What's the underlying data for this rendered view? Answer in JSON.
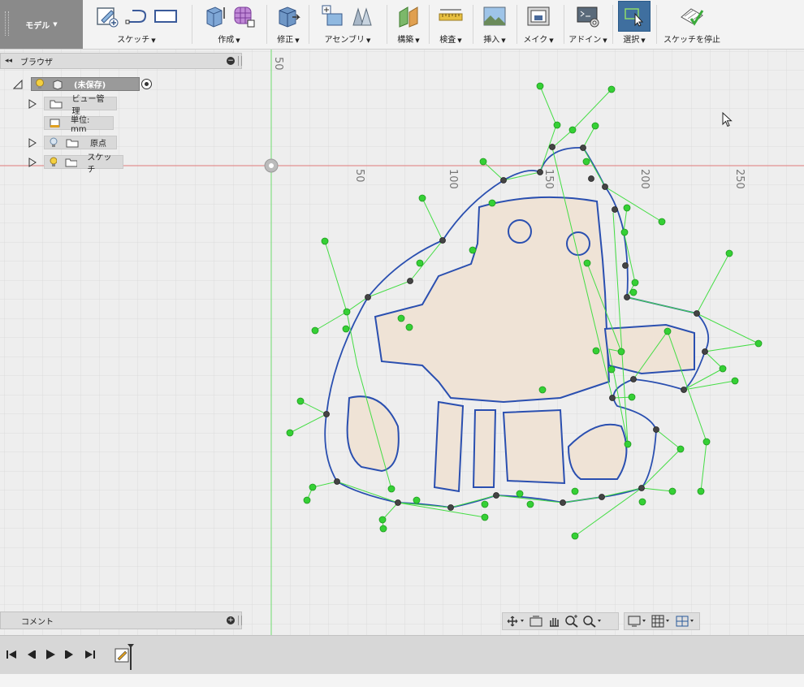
{
  "toolbar": {
    "workspace": "モデル",
    "groups": [
      {
        "label": "スケッチ"
      },
      {
        "label": "作成"
      },
      {
        "label": "修正"
      },
      {
        "label": "アセンブリ"
      },
      {
        "label": "構築"
      },
      {
        "label": "検査"
      },
      {
        "label": "挿入"
      },
      {
        "label": "メイク"
      },
      {
        "label": "アドイン"
      },
      {
        "label": "選択"
      },
      {
        "label": "スケッチを停止"
      }
    ]
  },
  "browser": {
    "title": "ブラウザ",
    "root": "(未保存)",
    "items": [
      {
        "label": "ビュー管理"
      },
      {
        "label": "単位: mm"
      },
      {
        "label": "原点"
      },
      {
        "label": "スケッチ"
      }
    ]
  },
  "comments": {
    "title": "コメント"
  },
  "ruler": {
    "vertical_label": "50",
    "h_ticks": [
      "50",
      "100",
      "150",
      "200",
      "250"
    ]
  },
  "colors": {
    "accent": "#3f6f9f",
    "spline": "#2a4fb0",
    "control": "#33cc33",
    "fill": "#efe3d6"
  }
}
